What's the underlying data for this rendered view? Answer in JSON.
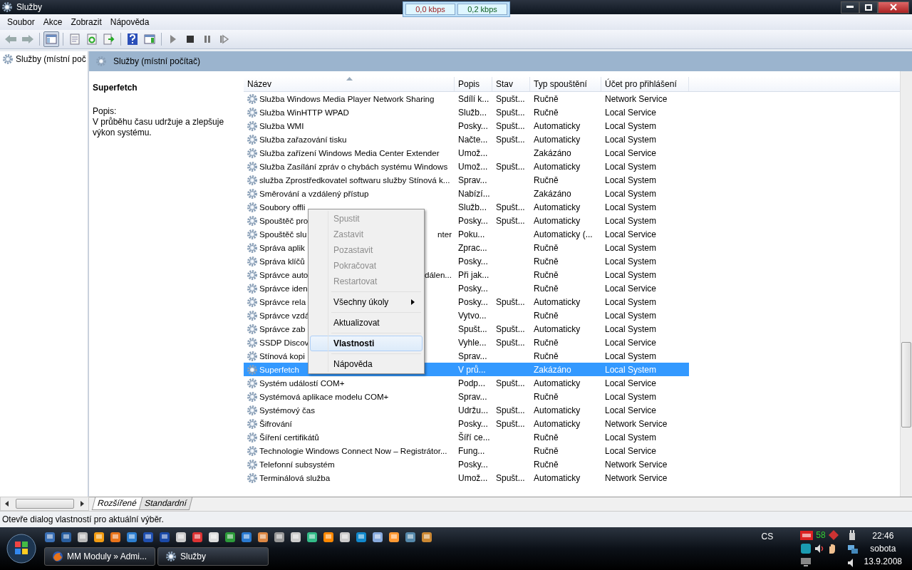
{
  "window": {
    "title": "Služby"
  },
  "net_meter": [
    "0,0 kbps",
    "0,2 kbps"
  ],
  "menu_bar": [
    "Soubor",
    "Akce",
    "Zobrazit",
    "Nápověda"
  ],
  "toolbar": [
    {
      "kind": "back",
      "pressed": false
    },
    {
      "kind": "forward",
      "pressed": false
    },
    {
      "kind": "sep"
    },
    {
      "kind": "tree",
      "pressed": true
    },
    {
      "kind": "sep"
    },
    {
      "kind": "properties",
      "pressed": false
    },
    {
      "kind": "refresh",
      "pressed": false
    },
    {
      "kind": "export",
      "pressed": false
    },
    {
      "kind": "sep"
    },
    {
      "kind": "help",
      "pressed": false
    },
    {
      "kind": "pane",
      "pressed": false
    },
    {
      "kind": "sep"
    },
    {
      "kind": "play",
      "pressed": false
    },
    {
      "kind": "stop",
      "pressed": false
    },
    {
      "kind": "pause",
      "pressed": false
    },
    {
      "kind": "resume",
      "pressed": false
    }
  ],
  "tree": {
    "items": [
      {
        "label": "Služby (místní poč",
        "selected": false
      }
    ]
  },
  "header_band": {
    "title": "Služby (místní počítač)"
  },
  "description": {
    "title": "Superfetch",
    "label": "Popis:",
    "text": "V průběhu času udržuje a zlepšuje výkon systému."
  },
  "table": {
    "columns": [
      {
        "label": "Název",
        "sorted": true
      },
      {
        "label": "Popis"
      },
      {
        "label": "Stav"
      },
      {
        "label": "Typ spouštění"
      },
      {
        "label": "Účet pro přihlášení"
      }
    ],
    "rows": [
      {
        "name": "Služba Windows Media Player Network Sharing",
        "desc": "Sdílí k...",
        "status": "Spušt...",
        "startup": "Ručně",
        "account": "Network Service",
        "selected": false
      },
      {
        "name": "Služba WinHTTP WPAD",
        "desc": "Služb...",
        "status": "Spušt...",
        "startup": "Ručně",
        "account": "Local Service",
        "selected": false
      },
      {
        "name": "Služba WMI",
        "desc": "Posky...",
        "status": "Spušt...",
        "startup": "Automaticky",
        "account": "Local System",
        "selected": false
      },
      {
        "name": "Služba zařazování tisku",
        "desc": "Načte...",
        "status": "Spušt...",
        "startup": "Automaticky",
        "account": "Local System",
        "selected": false
      },
      {
        "name": "Služba zařízení Windows Media Center Extender",
        "desc": "Umož...",
        "startup": "Zakázáno",
        "account": "Local Service",
        "selected": false
      },
      {
        "name": "Služba Zasílání zpráv o chybách systému Windows",
        "desc": "Umož...",
        "status": "Spušt...",
        "startup": "Automaticky",
        "account": "Local System",
        "selected": false
      },
      {
        "name": "služba Zprostředkovatel softwaru služby Stínová k...",
        "desc": "Sprav...",
        "startup": "Ručně",
        "account": "Local System",
        "selected": false
      },
      {
        "name": "Směrování a vzdálený přístup",
        "desc": "Nabízí...",
        "startup": "Zakázáno",
        "account": "Local System",
        "selected": false
      },
      {
        "name": "Soubory offli",
        "desc": "Služb...",
        "status": "Spušt...",
        "startup": "Automaticky",
        "account": "Local System",
        "selected": false
      },
      {
        "name": "Spouštěč pro",
        "desc": "Posky...",
        "status": "Spušt...",
        "startup": "Automaticky",
        "account": "Local System",
        "selected": false
      },
      {
        "name": "Spouštěč slu",
        "name_tail": "nter",
        "desc": "Poku...",
        "startup": "Automaticky (...",
        "account": "Local Service",
        "selected": false
      },
      {
        "name": "Správa aplik",
        "desc": "Zprac...",
        "startup": "Ručně",
        "account": "Local System",
        "selected": false
      },
      {
        "name": "Správa klíčů",
        "desc": "Posky...",
        "startup": "Ručně",
        "account": "Local System",
        "selected": false
      },
      {
        "name": "Správce auto",
        "name_tail": "dálen...",
        "desc": "Při jak...",
        "startup": "Ručně",
        "account": "Local System",
        "selected": false
      },
      {
        "name": "Správce iden",
        "desc": "Posky...",
        "startup": "Ručně",
        "account": "Local Service",
        "selected": false
      },
      {
        "name": "Správce rela",
        "desc": "Posky...",
        "status": "Spušt...",
        "startup": "Automaticky",
        "account": "Local System",
        "selected": false
      },
      {
        "name": "Správce vzdá",
        "desc": "Vytvo...",
        "startup": "Ručně",
        "account": "Local System",
        "selected": false
      },
      {
        "name": "Správce zab",
        "desc": "Spušt...",
        "status": "Spušt...",
        "startup": "Automaticky",
        "account": "Local System",
        "selected": false
      },
      {
        "name": "SSDP Discov",
        "desc": "Vyhle...",
        "status": "Spušt...",
        "startup": "Ručně",
        "account": "Local Service",
        "selected": false
      },
      {
        "name": "Stínová kopi",
        "desc": "Sprav...",
        "startup": "Ručně",
        "account": "Local System",
        "selected": false
      },
      {
        "name": "Superfetch",
        "desc": "V prů...",
        "startup": "Zakázáno",
        "account": "Local System",
        "selected": true
      },
      {
        "name": "Systém událostí COM+",
        "desc": "Podp...",
        "status": "Spušt...",
        "startup": "Automaticky",
        "account": "Local Service",
        "selected": false
      },
      {
        "name": "Systémová aplikace modelu COM+",
        "desc": "Sprav...",
        "startup": "Ručně",
        "account": "Local System",
        "selected": false
      },
      {
        "name": "Systémový čas",
        "desc": "Udržu...",
        "status": "Spušt...",
        "startup": "Automaticky",
        "account": "Local Service",
        "selected": false
      },
      {
        "name": "Šifrování",
        "desc": "Posky...",
        "status": "Spušt...",
        "startup": "Automaticky",
        "account": "Network Service",
        "selected": false
      },
      {
        "name": "Šíření certifikátů",
        "desc": "Šíří ce...",
        "startup": "Ručně",
        "account": "Local System",
        "selected": false
      },
      {
        "name": "Technologie Windows Connect Now – Registrátor...",
        "desc": "Fung...",
        "startup": "Ručně",
        "account": "Local Service",
        "selected": false
      },
      {
        "name": "Telefonní subsystém",
        "desc": "Posky...",
        "startup": "Ručně",
        "account": "Network Service",
        "selected": false
      },
      {
        "name": "Terminálová služba",
        "desc": "Umož...",
        "status": "Spušt...",
        "startup": "Automaticky",
        "account": "Network Service",
        "selected": false
      }
    ]
  },
  "context_menu": {
    "items": [
      {
        "kind": "item",
        "label": "Spustit",
        "disabled": true,
        "selected": false
      },
      {
        "kind": "item",
        "label": "Zastavit",
        "disabled": true,
        "selected": false
      },
      {
        "kind": "item",
        "label": "Pozastavit",
        "disabled": true,
        "selected": false
      },
      {
        "kind": "item",
        "label": "Pokračovat",
        "disabled": true,
        "selected": false
      },
      {
        "kind": "item",
        "label": "Restartovat",
        "disabled": true,
        "selected": false
      },
      {
        "kind": "separator"
      },
      {
        "kind": "submenu",
        "label": "Všechny úkoly",
        "disabled": false,
        "selected": false
      },
      {
        "kind": "separator"
      },
      {
        "kind": "item",
        "label": "Aktualizovat",
        "disabled": false,
        "selected": false
      },
      {
        "kind": "separator"
      },
      {
        "kind": "default",
        "label": "Vlastnosti",
        "disabled": false,
        "selected": true
      },
      {
        "kind": "separator"
      },
      {
        "kind": "item",
        "label": "Nápověda",
        "disabled": false,
        "selected": false
      }
    ]
  },
  "view_tabs": [
    {
      "label": "Rozšířené",
      "selected": true
    },
    {
      "label": "Standardní",
      "selected": false
    }
  ],
  "status_bar": "Otevře dialog vlastností pro aktuální výběr.",
  "taskbar": {
    "tasks": [
      {
        "label": "MM Moduly » Admi...",
        "kind": "browser"
      },
      {
        "label": "Služby",
        "kind": "services"
      }
    ],
    "language": "CS",
    "tray_counter": "58",
    "time": "22:46",
    "day": "sobota",
    "date": "13.9.2008"
  }
}
